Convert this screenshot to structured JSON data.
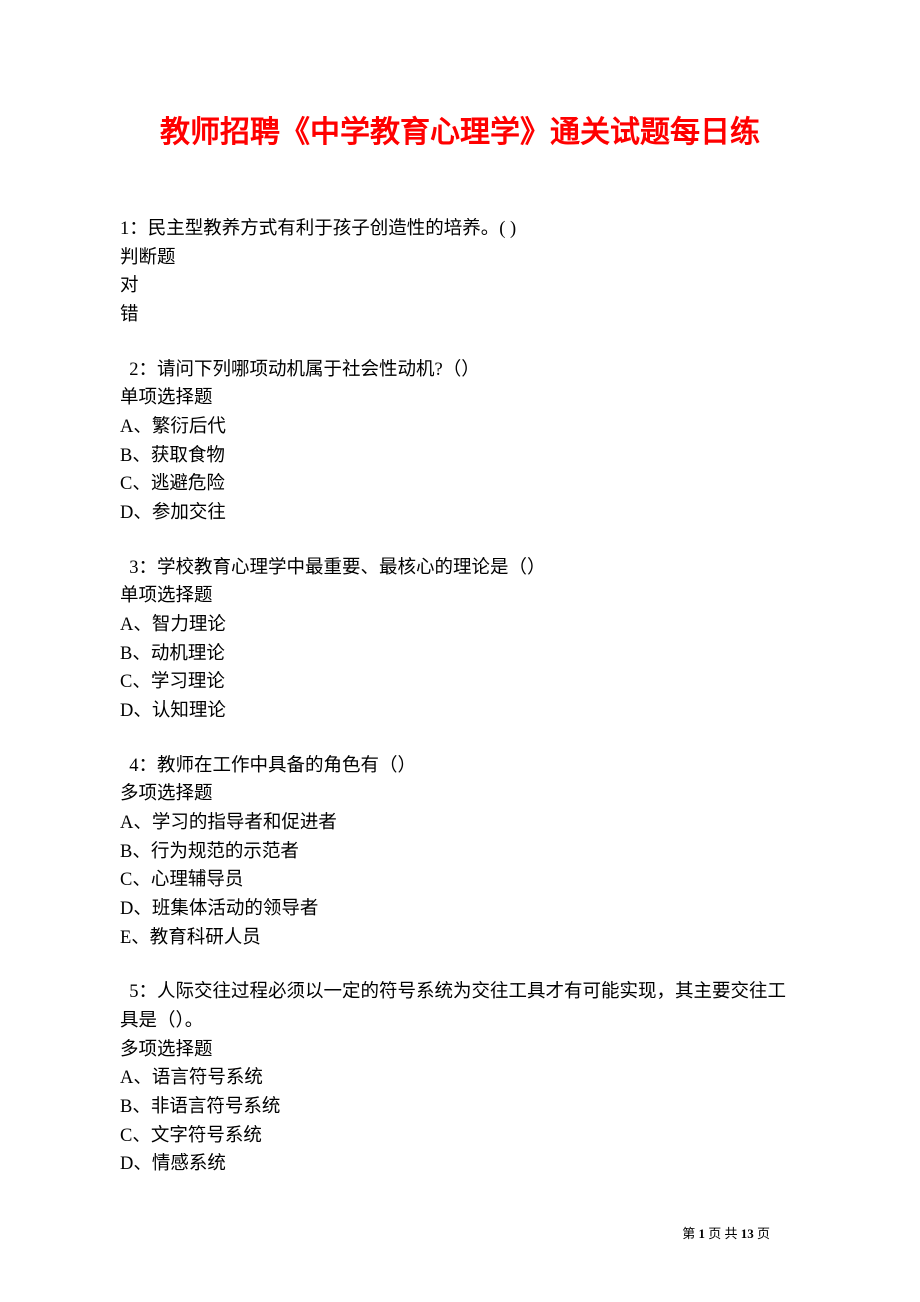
{
  "title": "教师招聘《中学教育心理学》通关试题每日练",
  "questions": [
    {
      "number": "1",
      "text": "：民主型教养方式有利于孩子创造性的培养。( )",
      "type": "判断题",
      "options": [
        "对",
        "错"
      ],
      "indent": false
    },
    {
      "number": "2",
      "text": "：请问下列哪项动机属于社会性动机?（）",
      "type": "单项选择题",
      "options": [
        "A、繁衍后代",
        "B、获取食物",
        "C、逃避危险",
        "D、参加交往"
      ],
      "indent": true
    },
    {
      "number": "3",
      "text": "：学校教育心理学中最重要、最核心的理论是（）",
      "type": "单项选择题",
      "options": [
        "A、智力理论",
        "B、动机理论",
        "C、学习理论",
        "D、认知理论"
      ],
      "indent": true
    },
    {
      "number": "4",
      "text": "：教师在工作中具备的角色有（）",
      "type": "多项选择题",
      "options": [
        "A、学习的指导者和促进者",
        "B、行为规范的示范者",
        "C、心理辅导员",
        "D、班集体活动的领导者",
        "E、教育科研人员"
      ],
      "indent": true
    },
    {
      "number": "5",
      "text": "：人际交往过程必须以一定的符号系统为交往工具才有可能实现，其主要交往工具是（）。",
      "type": "多项选择题",
      "options": [
        "A、语言符号系统",
        "B、非语言符号系统",
        "C、文字符号系统",
        "D、情感系统"
      ],
      "indent": true
    }
  ],
  "footer": {
    "prefix": "第 ",
    "current": "1",
    "middle": " 页 共 ",
    "total": "13",
    "suffix": " 页"
  }
}
